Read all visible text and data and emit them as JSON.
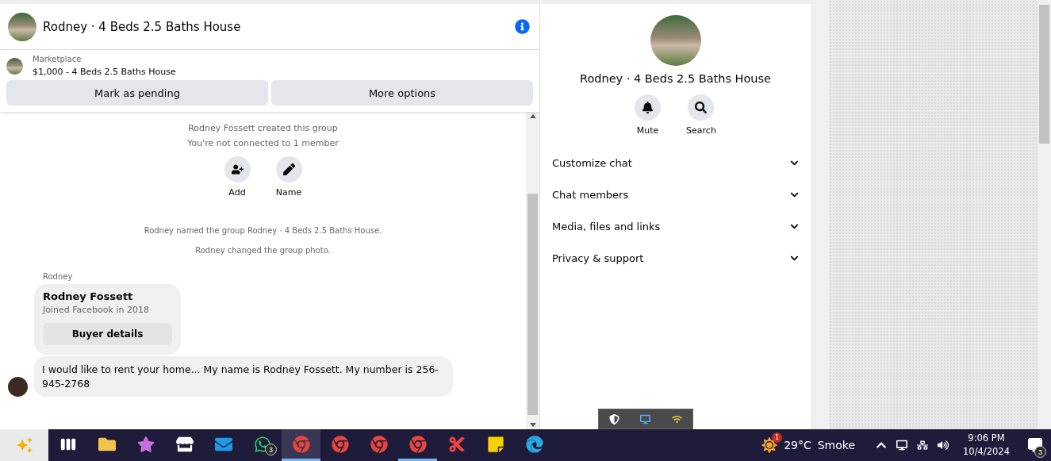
{
  "chat_header": {
    "title": "Rodney · 4 Beds 2.5 Baths House"
  },
  "listing": {
    "source": "Marketplace",
    "title": "$1,000 - 4 Beds 2.5 Baths House",
    "buttons": [
      "Mark as pending",
      "More options"
    ]
  },
  "conversation": {
    "intro": [
      "Rodney Fossett created this group",
      "You're not connected to 1 member"
    ],
    "actions": [
      {
        "kind": "add",
        "label": "Add"
      },
      {
        "kind": "name",
        "label": "Name"
      }
    ],
    "events": [
      "Rodney named the group Rodney · 4 Beds 2.5 Baths House.",
      "Rodney changed the group photo."
    ],
    "sender": "Rodney",
    "buyer_card": {
      "name": "Rodney Fossett",
      "subtitle": "Joined Facebook in 2018",
      "button": "Buyer details"
    },
    "message": "I would like to rent your home... My name is Rodney Fossett. My number is 256-945-2768"
  },
  "details": {
    "title": "Rodney · 4 Beds 2.5 Baths House",
    "actions": [
      {
        "kind": "mute",
        "label": "Mute"
      },
      {
        "kind": "search",
        "label": "Search"
      }
    ],
    "sections": [
      {
        "label": "Customize chat",
        "expanded": false
      },
      {
        "label": "Chat members",
        "expanded": false
      },
      {
        "label": "Media, files and links",
        "expanded": false
      },
      {
        "label": "Privacy & support",
        "expanded": false
      }
    ]
  },
  "tray_popup": [
    {
      "kind": "shield"
    },
    {
      "kind": "monitor"
    },
    {
      "kind": "hotspot"
    }
  ],
  "taskbar": {
    "apps": [
      {
        "kind": "taskview",
        "selected": false,
        "open": false
      },
      {
        "kind": "folder",
        "selected": false,
        "open": false
      },
      {
        "kind": "copilot",
        "selected": false,
        "open": false
      },
      {
        "kind": "store",
        "selected": false,
        "open": false
      },
      {
        "kind": "mail",
        "selected": false,
        "open": false
      },
      {
        "kind": "whatsapp",
        "selected": false,
        "open": false,
        "badge": "3"
      },
      {
        "kind": "chrome",
        "selected": true,
        "open": true
      },
      {
        "kind": "chrome",
        "selected": false,
        "open": false
      },
      {
        "kind": "chrome",
        "selected": false,
        "open": false
      },
      {
        "kind": "chrome",
        "selected": false,
        "open": true
      },
      {
        "kind": "snip",
        "selected": false,
        "open": false
      },
      {
        "kind": "notes",
        "selected": false,
        "open": false
      },
      {
        "kind": "edge",
        "selected": false,
        "open": false
      }
    ],
    "weather": {
      "badge": "1",
      "temperature": "29°C",
      "condition": "Smoke"
    },
    "time": "9:06 PM",
    "date": "10/4/2024",
    "notifications": "3"
  }
}
